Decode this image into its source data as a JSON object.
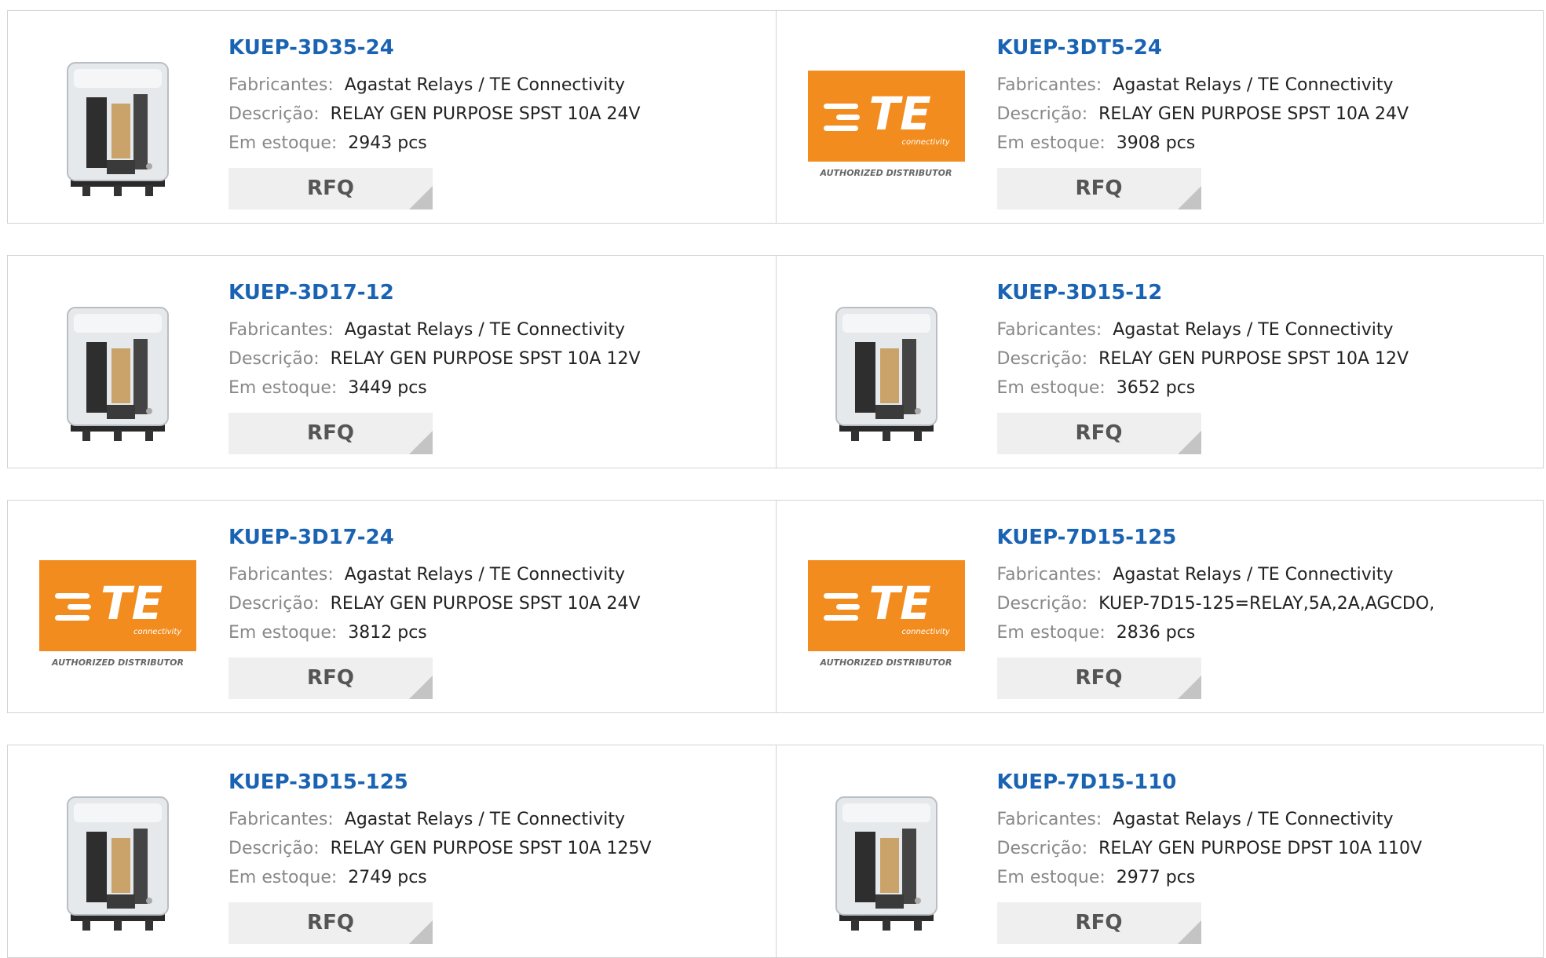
{
  "labels": {
    "manufacturer": "Fabricantes:",
    "description": "Descrição:",
    "stock": "Em estoque:",
    "rfq": "RFQ"
  },
  "te_logo": {
    "letters": "TE",
    "sub": "connectivity",
    "tagline": "AUTHORIZED DISTRIBUTOR",
    "color": "#f28c1e"
  },
  "colors": {
    "part_link": "#1a63b3",
    "label": "#888888",
    "border": "#d3d3d3",
    "button": "#efefef"
  },
  "products": [
    {
      "part": "KUEP-3D35-24",
      "manufacturer": "Agastat Relays / TE Connectivity",
      "description": "RELAY GEN PURPOSE SPST 10A 24V",
      "stock": "2943 pcs",
      "image": "relay-photo"
    },
    {
      "part": "KUEP-3DT5-24",
      "manufacturer": "Agastat Relays / TE Connectivity",
      "description": "RELAY GEN PURPOSE SPST 10A 24V",
      "stock": "3908 pcs",
      "image": "te-logo"
    },
    {
      "part": "KUEP-3D17-12",
      "manufacturer": "Agastat Relays / TE Connectivity",
      "description": "RELAY GEN PURPOSE SPST 10A 12V",
      "stock": "3449 pcs",
      "image": "relay-photo"
    },
    {
      "part": "KUEP-3D15-12",
      "manufacturer": "Agastat Relays / TE Connectivity",
      "description": "RELAY GEN PURPOSE SPST 10A 12V",
      "stock": "3652 pcs",
      "image": "relay-photo"
    },
    {
      "part": "KUEP-3D17-24",
      "manufacturer": "Agastat Relays / TE Connectivity",
      "description": "RELAY GEN PURPOSE SPST 10A 24V",
      "stock": "3812 pcs",
      "image": "te-logo"
    },
    {
      "part": "KUEP-7D15-125",
      "manufacturer": "Agastat Relays / TE Connectivity",
      "description": "KUEP-7D15-125=RELAY,5A,2A,AGCDO,",
      "stock": "2836 pcs",
      "image": "te-logo"
    },
    {
      "part": "KUEP-3D15-125",
      "manufacturer": "Agastat Relays / TE Connectivity",
      "description": "RELAY GEN PURPOSE SPST 10A 125V",
      "stock": "2749 pcs",
      "image": "relay-photo"
    },
    {
      "part": "KUEP-7D15-110",
      "manufacturer": "Agastat Relays / TE Connectivity",
      "description": "RELAY GEN PURPOSE DPST 10A 110V",
      "stock": "2977 pcs",
      "image": "relay-photo"
    }
  ]
}
